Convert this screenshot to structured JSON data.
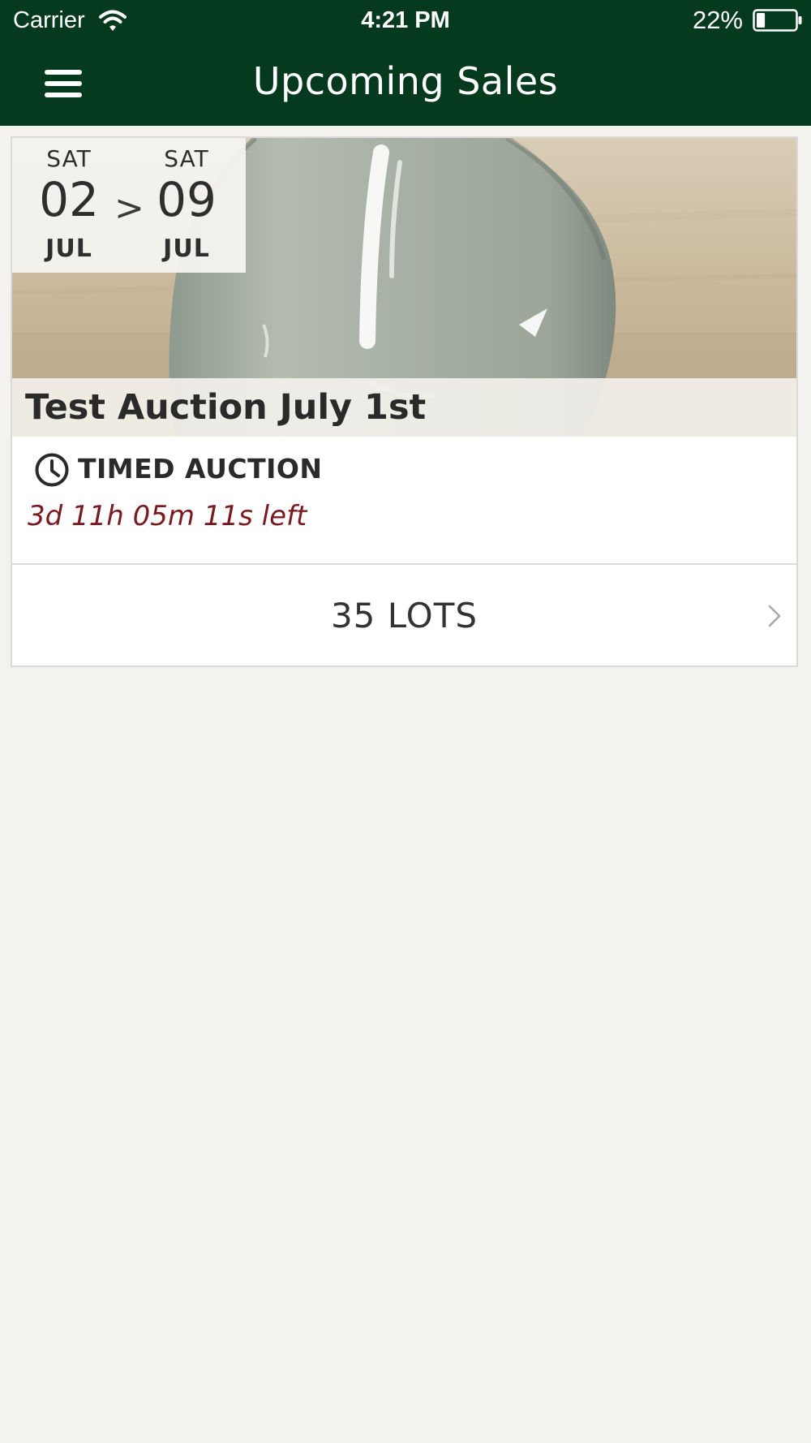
{
  "status_bar": {
    "carrier": "Carrier",
    "time": "4:21 PM",
    "battery_percent": "22%",
    "battery_level": 0.22,
    "icons": [
      "wifi-icon",
      "battery-icon"
    ]
  },
  "nav": {
    "title": "Upcoming Sales",
    "menu_icon": "hamburger-menu-icon"
  },
  "colors": {
    "header_bg": "#063a1f",
    "page_bg": "#f4f2ef",
    "time_left": "#7a1a1f",
    "text": "#2a2a2a"
  },
  "sales": [
    {
      "start": {
        "weekday": "SAT",
        "day": "02",
        "month": "JUL"
      },
      "separator": ">",
      "end": {
        "weekday": "SAT",
        "day": "09",
        "month": "JUL"
      },
      "title": "Test Auction July 1st",
      "type_icon": "clock-icon",
      "type": "TIMED AUCTION",
      "time_left": "3d 11h 05m 11s left",
      "lots_label": "35 LOTS",
      "lots_icon": "chevron-right-icon"
    }
  ]
}
